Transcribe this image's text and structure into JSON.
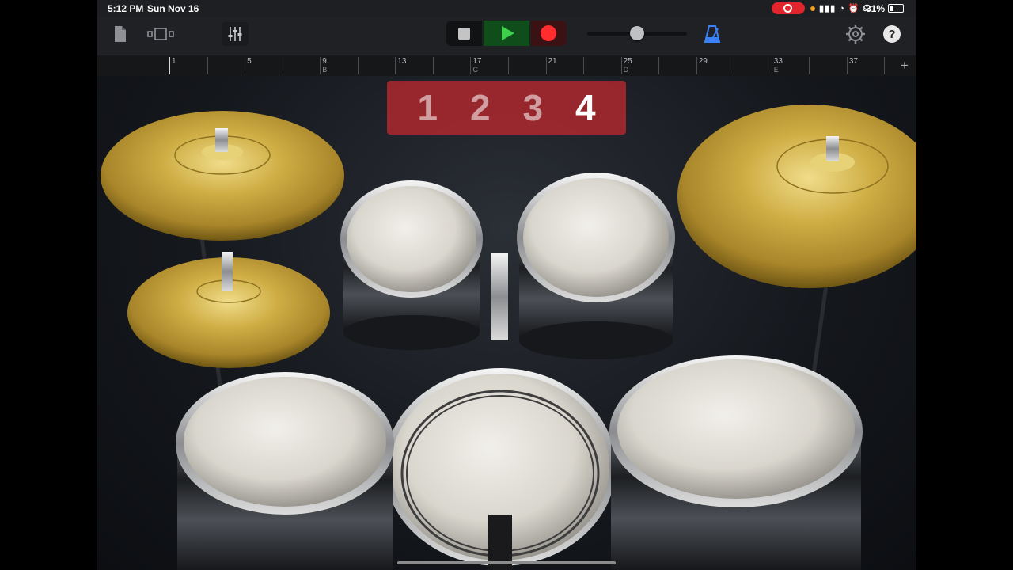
{
  "status": {
    "time": "5:12 PM",
    "date": "Sun Nov 16",
    "battery": "31%"
  },
  "toolbar": {
    "icons": [
      "document-icon",
      "tracks-view-icon",
      "mixer-icon",
      "stop-icon",
      "play-icon",
      "record-icon",
      "metronome-icon",
      "settings-icon",
      "help-icon"
    ],
    "help_label": "?",
    "volume_level": 0.5,
    "colors": {
      "play": "#3dd14c",
      "record": "#ff2d2d",
      "metronome": "#3b82f6"
    }
  },
  "ruler": {
    "bars": [
      "1",
      "5",
      "9",
      "13",
      "17",
      "21",
      "25",
      "29",
      "33",
      "37"
    ],
    "sections": [
      "",
      "",
      "B",
      "",
      "C",
      "",
      "D",
      "",
      "E",
      ""
    ],
    "add_label": "+"
  },
  "count_in": {
    "numbers": [
      "1",
      "2",
      "3",
      "4"
    ],
    "active_index": 3,
    "color": "#b2282e"
  },
  "instrument": {
    "name": "drum-kit",
    "pieces": [
      "crash-cymbal",
      "hi-hat",
      "ride-cymbal",
      "tom-1",
      "tom-2",
      "floor-tom-left",
      "floor-tom-right",
      "kick-drum"
    ]
  }
}
